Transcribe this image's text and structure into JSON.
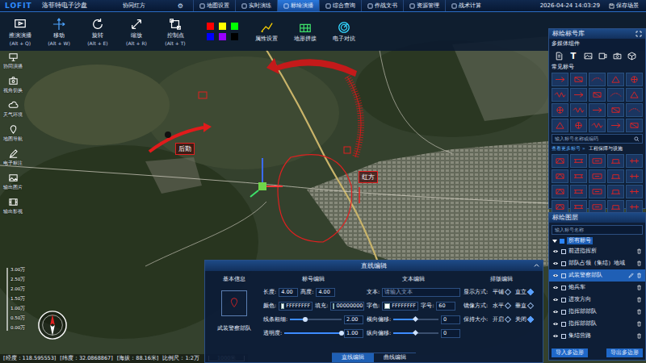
{
  "app": {
    "logo": "LOFIT",
    "title": "洛菲特电子沙盘",
    "role": "协同红方",
    "gear": "⚙"
  },
  "nav_tabs": [
    {
      "label": "地图设置",
      "selected": false
    },
    {
      "label": "实时演练",
      "selected": false
    },
    {
      "label": "标绘演播",
      "selected": true
    },
    {
      "label": "综合查询",
      "selected": false
    },
    {
      "label": "作战文书",
      "selected": false
    },
    {
      "label": "资源管理",
      "selected": false
    },
    {
      "label": "战术计算",
      "selected": false
    }
  ],
  "datetime": "2026-04-24  14:03:29",
  "save_button": "保存场景",
  "tools": [
    {
      "label": "推演演播",
      "shortcut": "(Alt + Q)",
      "kind": "play",
      "selected": false
    },
    {
      "label": "移动",
      "shortcut": "(Alt + W)",
      "kind": "move",
      "selected": false
    },
    {
      "label": "旋转",
      "shortcut": "(Alt + E)",
      "kind": "rotate",
      "selected": false
    },
    {
      "label": "缩放",
      "shortcut": "(Alt + R)",
      "kind": "scale",
      "selected": false
    },
    {
      "label": "控制点",
      "shortcut": "(Alt + T)",
      "kind": "control",
      "selected": false
    }
  ],
  "swatches": [
    {
      "color": "#ff0000",
      "selected": false
    },
    {
      "color": "#ffff00",
      "selected": false
    },
    {
      "color": "#00ff00",
      "selected": false
    },
    {
      "color": "#0000ff",
      "selected": false
    },
    {
      "color": "#9900ff",
      "selected": false
    },
    {
      "color": "#000000",
      "selected": false
    }
  ],
  "actions": [
    {
      "label": "属性设置",
      "kind": "props"
    },
    {
      "label": "地形拼接",
      "kind": "terrain"
    },
    {
      "label": "电子对抗",
      "kind": "radar"
    }
  ],
  "sidebar": [
    {
      "label": "协同演播",
      "kind": "collab"
    },
    {
      "label": "视角切换",
      "kind": "view"
    },
    {
      "label": "天气环境",
      "kind": "weather"
    },
    {
      "label": "地图导航",
      "kind": "nav"
    },
    {
      "label": "电子标注",
      "kind": "annotate"
    },
    {
      "label": "输出图片",
      "kind": "image"
    },
    {
      "label": "输出影视",
      "kind": "video"
    }
  ],
  "altitude_scale": [
    "3.00万",
    "2.50万",
    "2.00万",
    "1.50万",
    "1.00万",
    "0.50万",
    "0.00万"
  ],
  "map": {
    "labels": [
      "后勤",
      "红方"
    ]
  },
  "status_bar": {
    "longitude": "[经度：118.595553]",
    "latitude": "[纬度：32.0868867]",
    "altitude": "[海拔：88.16米]",
    "scale": "比例尺：1:2万",
    "scale_bar": "1000米"
  },
  "symbol_library": {
    "title": "标绘标号库",
    "media_title": "多媒体组件",
    "media": [
      {
        "kind": "doc",
        "glyph": ""
      },
      {
        "kind": "text",
        "glyph": "T"
      },
      {
        "kind": "image",
        "glyph": ""
      },
      {
        "kind": "video",
        "glyph": ""
      },
      {
        "kind": "camera",
        "glyph": ""
      },
      {
        "kind": "cube",
        "glyph": ""
      }
    ],
    "common_title": "常见标号",
    "search_placeholder": "输入标号名称或编码",
    "more_link": "查看更多标号 »",
    "category": "工程保障与设施"
  },
  "layers": {
    "title": "标绘图层",
    "search_placeholder": "输入标号名称",
    "root": {
      "label": "所有标号",
      "checked": true,
      "expanded": true
    },
    "items": [
      {
        "label": "前进指挥所",
        "selected": false,
        "visible": true
      },
      {
        "label": "部队占领（集结）地域",
        "selected": false,
        "visible": true
      },
      {
        "label": "武装警察部队",
        "selected": true,
        "visible": true
      },
      {
        "label": "炮兵车",
        "selected": false,
        "visible": true
      },
      {
        "label": "进攻方向",
        "selected": false,
        "visible": true
      },
      {
        "label": "指挥部部队",
        "selected": false,
        "visible": true
      },
      {
        "label": "指挥部部队",
        "selected": false,
        "visible": true
      },
      {
        "label": "集结营路",
        "selected": false,
        "visible": true
      }
    ],
    "buttons": [
      "导入多边形",
      "导出多边形"
    ]
  },
  "editor": {
    "title": "直线编辑",
    "sections": [
      "基本信息",
      "标号编辑",
      "文本编辑",
      "排版编辑"
    ],
    "preview_label": "武装警察部队",
    "size_fields": [
      {
        "label": "长度:",
        "value": "4.00"
      },
      {
        "label": "高度:",
        "value": "4.00"
      }
    ],
    "color_fields": [
      {
        "label": "颜色:",
        "value": "FFFFFFFF",
        "color": "#ffffff"
      },
      {
        "label": "填充:",
        "value": "00000000",
        "color": "#15243d"
      }
    ],
    "sliders": [
      {
        "label": "线条粗细:",
        "level": 0.3,
        "reading": "2.00"
      },
      {
        "label": "透明度:",
        "level": 1,
        "reading": "1.00"
      }
    ],
    "text": {
      "label": "文本:",
      "placeholder": "请输入文本",
      "color_label": "字色:",
      "color_value": "FFFFFFFF",
      "color": "#ffffff",
      "size_label": "字号:",
      "size_value": "60"
    },
    "offsets": [
      {
        "label": "横向偏移:",
        "level": 0.5,
        "reading": "0"
      },
      {
        "label": "纵向偏移:",
        "level": 0.5,
        "reading": "0"
      }
    ],
    "layout": [
      {
        "label": "显示方式:",
        "options": [
          {
            "label": "平铺",
            "selected": false
          },
          {
            "label": "直立",
            "selected": true
          }
        ]
      },
      {
        "label": "镜像方式:",
        "options": [
          {
            "label": "水平",
            "selected": false
          },
          {
            "label": "垂直",
            "selected": false
          }
        ]
      },
      {
        "label": "保持大小:",
        "options": [
          {
            "label": "开启",
            "selected": false
          },
          {
            "label": "关闭",
            "selected": true
          }
        ]
      }
    ],
    "tabs": [
      {
        "label": "直线编辑",
        "selected": true
      },
      {
        "label": "曲线编辑",
        "selected": false
      }
    ]
  }
}
